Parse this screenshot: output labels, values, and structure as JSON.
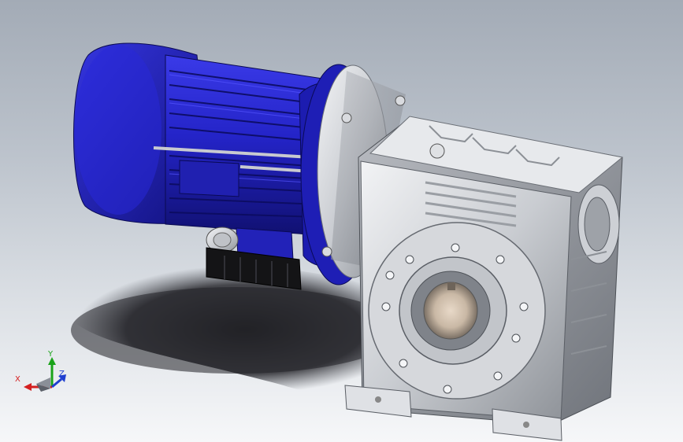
{
  "viewport": {
    "background_top": "#a3abb6",
    "background_bottom": "#f6f7f9"
  },
  "model": {
    "motor_color": "#2020c8",
    "gearbox_color": "#cfd2d6"
  },
  "triad": {
    "x_label": "X",
    "y_label": "Y",
    "z_label": "Z",
    "x_color": "#d42020",
    "y_color": "#1aa31a",
    "z_color": "#2040d0",
    "icon": "coordinate-triad-icon"
  }
}
